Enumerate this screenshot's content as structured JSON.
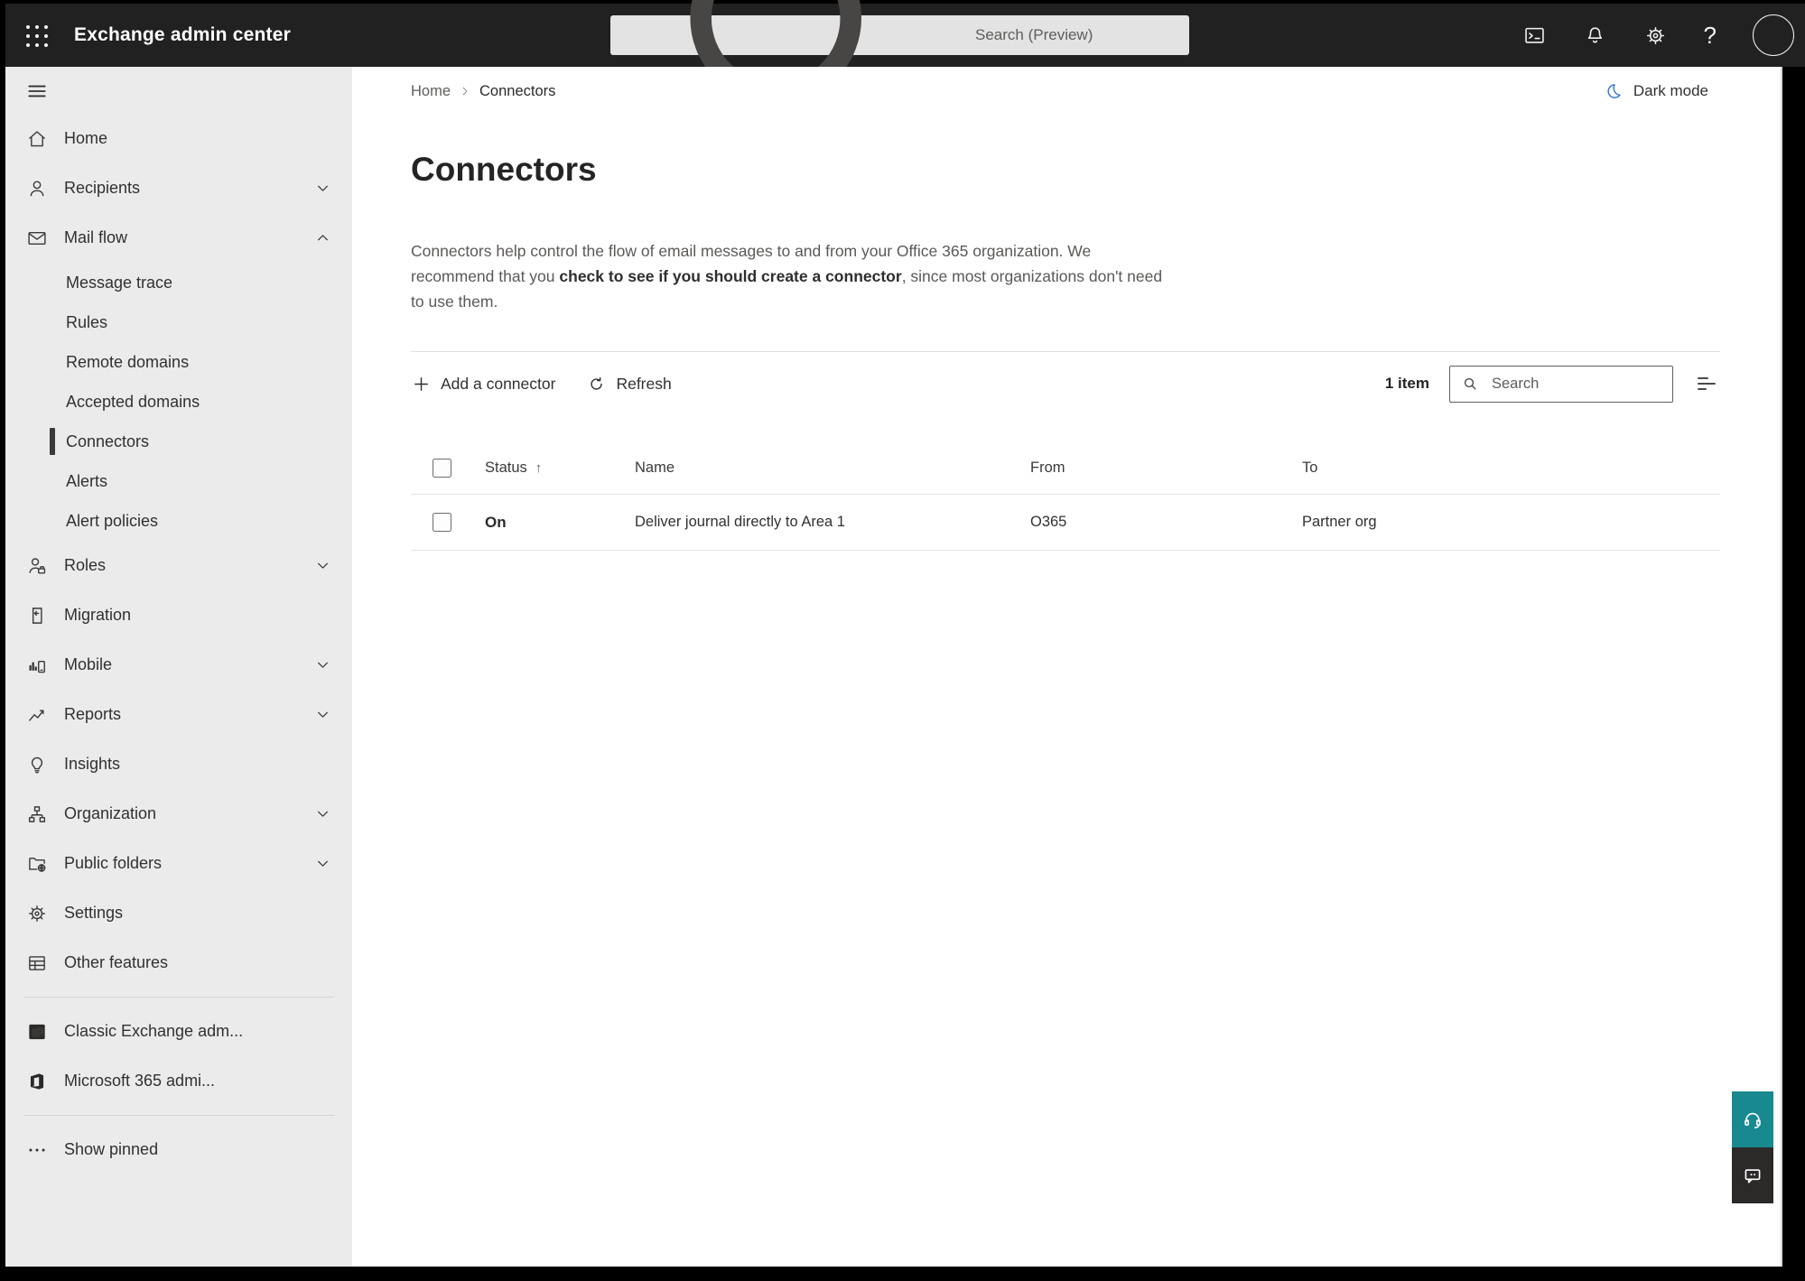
{
  "app": {
    "title": "Exchange admin center",
    "search_placeholder": "Search (Preview)"
  },
  "breadcrumb": {
    "home": "Home",
    "current": "Connectors"
  },
  "dark_mode_label": "Dark mode",
  "sidebar": {
    "items": [
      {
        "label": "Home",
        "icon": "home-icon"
      },
      {
        "label": "Recipients",
        "icon": "person-icon",
        "chevron": "down"
      },
      {
        "label": "Mail flow",
        "icon": "mail-icon",
        "chevron": "up",
        "expanded": true
      },
      {
        "label": "Message trace",
        "type": "sub"
      },
      {
        "label": "Rules",
        "type": "sub"
      },
      {
        "label": "Remote domains",
        "type": "sub"
      },
      {
        "label": "Accepted domains",
        "type": "sub"
      },
      {
        "label": "Connectors",
        "type": "sub",
        "selected": true
      },
      {
        "label": "Alerts",
        "type": "sub"
      },
      {
        "label": "Alert policies",
        "type": "sub"
      },
      {
        "label": "Roles",
        "icon": "person-briefcase-icon",
        "chevron": "down"
      },
      {
        "label": "Migration",
        "icon": "document-arrow-icon"
      },
      {
        "label": "Mobile",
        "icon": "phone-chart-icon",
        "chevron": "down"
      },
      {
        "label": "Reports",
        "icon": "line-chart-icon",
        "chevron": "down"
      },
      {
        "label": "Insights",
        "icon": "lightbulb-icon"
      },
      {
        "label": "Organization",
        "icon": "org-chart-icon",
        "chevron": "down"
      },
      {
        "label": "Public folders",
        "icon": "folder-globe-icon",
        "chevron": "down"
      },
      {
        "label": "Settings",
        "icon": "gear-icon"
      },
      {
        "label": "Other features",
        "icon": "grid-table-icon"
      },
      {
        "label": "Classic Exchange adm...",
        "icon": "exchange-logo-icon"
      },
      {
        "label": "Microsoft 365 admi...",
        "icon": "office-logo-icon"
      },
      {
        "label": "Show pinned",
        "icon": "ellipsis-icon"
      }
    ]
  },
  "page": {
    "title": "Connectors",
    "description_1": "Connectors help control the flow of email messages to and from your Office 365 organization. We recommend that you ",
    "description_link": "check to see if you should create a connector",
    "description_2": ", since most organizations don't need to use them."
  },
  "toolbar": {
    "add_label": "Add a connector",
    "refresh_label": "Refresh",
    "item_count": "1 item",
    "search_placeholder": "Search"
  },
  "table": {
    "headers": {
      "status": "Status",
      "name": "Name",
      "from": "From",
      "to": "To"
    },
    "sort_icon": "↑",
    "rows": [
      {
        "status": "On",
        "name": "Deliver journal directly to Area 1",
        "from": "O365",
        "to": "Partner org"
      }
    ]
  },
  "colors": {
    "topbar": "#212121",
    "sidebar_bg": "#ebebeb",
    "moon_blue": "#3B76D6",
    "help_button_teal": "#17898F",
    "chat_button_dark": "#2b2a29",
    "selected_indicator": "#3a3a38"
  }
}
